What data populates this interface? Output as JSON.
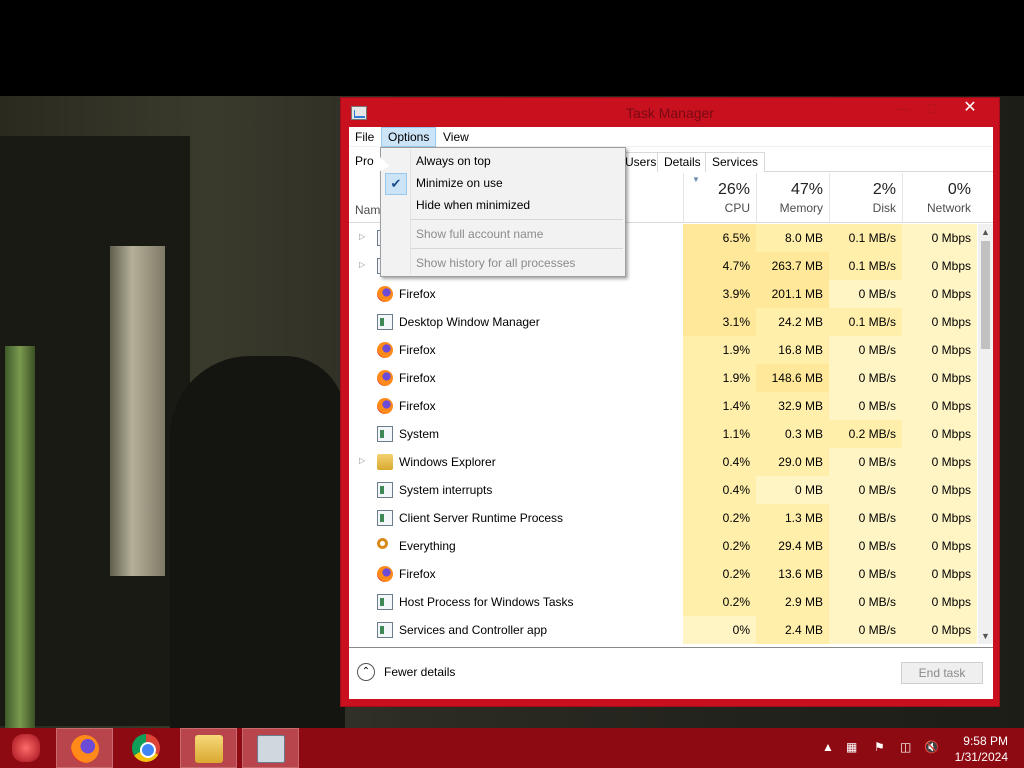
{
  "window": {
    "title": "Task Manager"
  },
  "menubar": {
    "file": "File",
    "options": "Options",
    "view": "View"
  },
  "tabs": {
    "processes_partial": "Pro",
    "users_partial": "Users",
    "details": "Details",
    "services": "Services"
  },
  "header": {
    "name": "Nam",
    "cpu_pct": "26%",
    "cpu_label": "CPU",
    "memory_pct": "47%",
    "memory_label": "Memory",
    "disk_pct": "2%",
    "disk_label": "Disk",
    "network_pct": "0%",
    "network_label": "Network"
  },
  "options_menu": {
    "always_on_top": "Always on top",
    "minimize_on_use": "Minimize on use",
    "minimize_on_use_checked": true,
    "hide_when_minimized": "Hide when minimized",
    "show_full_account_name": "Show full account name",
    "show_history": "Show history for all processes"
  },
  "processes": [
    {
      "name": "",
      "icon": "app-icon",
      "expandable": true,
      "cpu": "6.5%",
      "memory": "8.0 MB",
      "disk": "0.1 MB/s",
      "network": "0 Mbps"
    },
    {
      "name": "",
      "icon": "app-icon",
      "expandable": true,
      "cpu": "4.7%",
      "memory": "263.7 MB",
      "disk": "0.1 MB/s",
      "network": "0 Mbps"
    },
    {
      "name": "Firefox",
      "icon": "firefox-icon",
      "expandable": false,
      "cpu": "3.9%",
      "memory": "201.1 MB",
      "disk": "0 MB/s",
      "network": "0 Mbps"
    },
    {
      "name": "Desktop Window Manager",
      "icon": "app-icon",
      "expandable": false,
      "cpu": "3.1%",
      "memory": "24.2 MB",
      "disk": "0.1 MB/s",
      "network": "0 Mbps"
    },
    {
      "name": "Firefox",
      "icon": "firefox-icon",
      "expandable": false,
      "cpu": "1.9%",
      "memory": "16.8 MB",
      "disk": "0 MB/s",
      "network": "0 Mbps"
    },
    {
      "name": "Firefox",
      "icon": "firefox-icon",
      "expandable": false,
      "cpu": "1.9%",
      "memory": "148.6 MB",
      "disk": "0 MB/s",
      "network": "0 Mbps"
    },
    {
      "name": "Firefox",
      "icon": "firefox-icon",
      "expandable": false,
      "cpu": "1.4%",
      "memory": "32.9 MB",
      "disk": "0 MB/s",
      "network": "0 Mbps"
    },
    {
      "name": "System",
      "icon": "app-icon",
      "expandable": false,
      "cpu": "1.1%",
      "memory": "0.3 MB",
      "disk": "0.2 MB/s",
      "network": "0 Mbps"
    },
    {
      "name": "Windows Explorer",
      "icon": "folder-icon",
      "expandable": true,
      "cpu": "0.4%",
      "memory": "29.0 MB",
      "disk": "0 MB/s",
      "network": "0 Mbps"
    },
    {
      "name": "System interrupts",
      "icon": "app-icon",
      "expandable": false,
      "cpu": "0.4%",
      "memory": "0 MB",
      "disk": "0 MB/s",
      "network": "0 Mbps"
    },
    {
      "name": "Client Server Runtime Process",
      "icon": "app-icon",
      "expandable": false,
      "cpu": "0.2%",
      "memory": "1.3 MB",
      "disk": "0 MB/s",
      "network": "0 Mbps"
    },
    {
      "name": "Everything",
      "icon": "search-icon",
      "expandable": false,
      "cpu": "0.2%",
      "memory": "29.4 MB",
      "disk": "0 MB/s",
      "network": "0 Mbps"
    },
    {
      "name": "Firefox",
      "icon": "firefox-icon",
      "expandable": false,
      "cpu": "0.2%",
      "memory": "13.6 MB",
      "disk": "0 MB/s",
      "network": "0 Mbps"
    },
    {
      "name": "Host Process for Windows Tasks",
      "icon": "app-icon",
      "expandable": false,
      "cpu": "0.2%",
      "memory": "2.9 MB",
      "disk": "0 MB/s",
      "network": "0 Mbps"
    },
    {
      "name": "Services and Controller app",
      "icon": "app-icon",
      "expandable": false,
      "cpu": "0%",
      "memory": "2.4 MB",
      "disk": "0 MB/s",
      "network": "0 Mbps"
    }
  ],
  "footer": {
    "fewer_details": "Fewer details",
    "end_task": "End task"
  },
  "taskbar": {
    "items": [
      "start-icon",
      "firefox-icon",
      "chrome-icon",
      "file-explorer-icon",
      "task-manager-icon"
    ],
    "time": "9:58 PM",
    "date": "1/31/2024"
  }
}
